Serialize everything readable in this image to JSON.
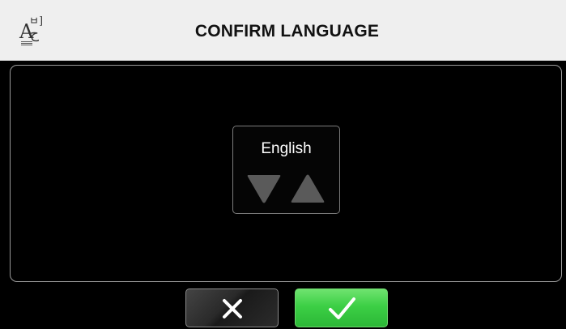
{
  "header": {
    "title": "CONFIRM LANGUAGE",
    "icon": "language-icon"
  },
  "selector": {
    "language": "English",
    "down_icon": "triangle-down-icon",
    "up_icon": "triangle-up-icon"
  },
  "actions": {
    "cancel_icon": "close-icon",
    "confirm_icon": "checkmark-icon"
  },
  "colors": {
    "header_bg": "#efefef",
    "screen_bg": "#000000",
    "confirm_green": "#3ccf45",
    "arrow_gray": "#5a5a5a"
  }
}
